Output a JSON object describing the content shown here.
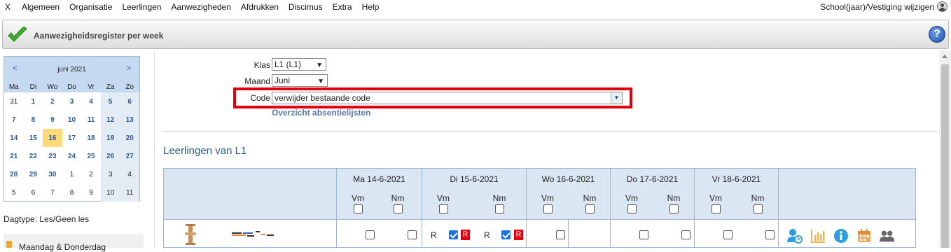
{
  "menu": {
    "items": [
      "X",
      "Algemeen",
      "Organisatie",
      "Leerlingen",
      "Aanwezigheden",
      "Afdrukken",
      "Discimus",
      "Extra",
      "Help"
    ],
    "right": "School(jaar)/Vestiging wijzigen"
  },
  "title": "Aanwezigheidsregister per week",
  "calendar": {
    "prev": "<",
    "next": ">",
    "month": "juni 2021",
    "days": [
      "Ma",
      "Di",
      "Wo",
      "Do",
      "Vr",
      "Za",
      "Zo"
    ],
    "weeks": [
      [
        "31",
        "1",
        "2",
        "3",
        "4",
        "5",
        "6"
      ],
      [
        "7",
        "8",
        "9",
        "10",
        "11",
        "12",
        "13"
      ],
      [
        "14",
        "15",
        "16",
        "17",
        "18",
        "19",
        "20"
      ],
      [
        "21",
        "22",
        "23",
        "24",
        "25",
        "26",
        "27"
      ],
      [
        "28",
        "29",
        "30",
        "1",
        "2",
        "3",
        "4"
      ],
      [
        "5",
        "6",
        "7",
        "8",
        "9",
        "10",
        "11"
      ]
    ]
  },
  "dagtype": "Dagtype: Les/Geen les",
  "legend": "Maandag & Donderdag",
  "form": {
    "klas_label": "Klas",
    "klas_value": "L1 (L1)",
    "maand_label": "Maand",
    "maand_value": "Juni",
    "code_label": "Code",
    "code_value": "verwijder bestaande code",
    "overzicht": "Overzicht absentielijsten"
  },
  "section_title": "Leerlingen van L1",
  "grid": {
    "days": [
      "Ma 14-6-2021",
      "Di 15-6-2021",
      "Wo 16-6-2021",
      "Do 17-6-2021",
      "Vr 18-6-2021"
    ],
    "vm": "Vm",
    "nm": "Nm",
    "r": "R"
  },
  "icons": [
    "user-clock-icon",
    "chart-icon",
    "info-icon",
    "calendar-icon",
    "users-icon"
  ],
  "colors": {
    "accent": "#2d5b9a",
    "highlight": "#e2000f",
    "today": "#ffd87a"
  }
}
